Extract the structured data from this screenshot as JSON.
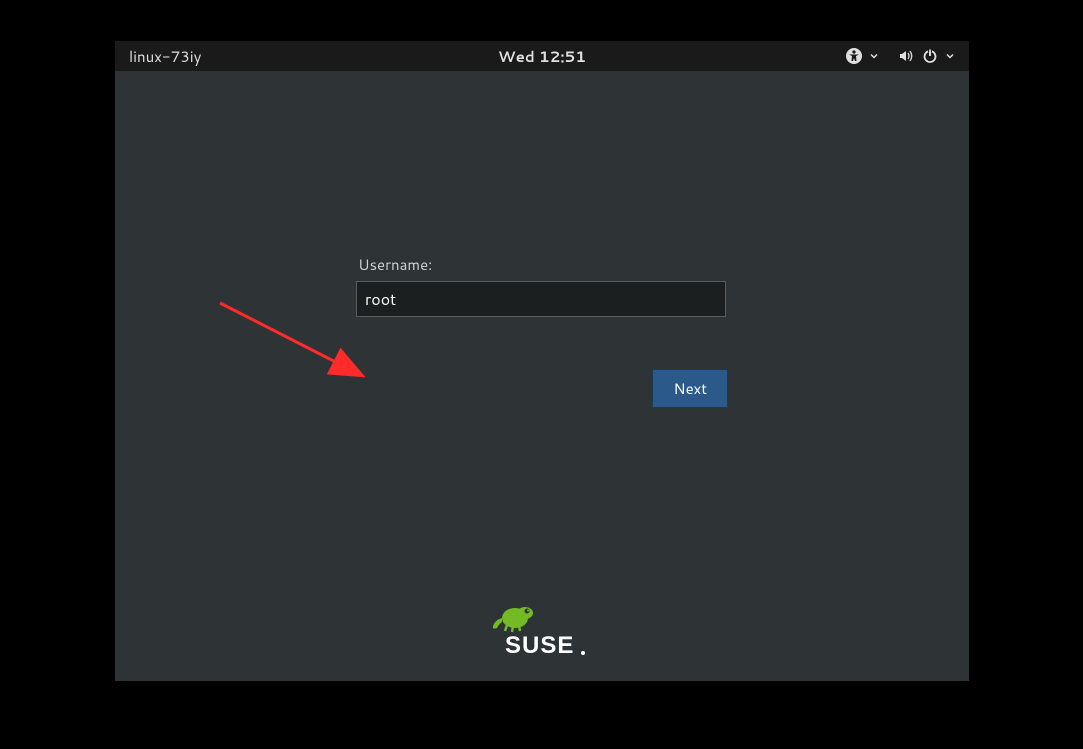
{
  "topbar": {
    "hostname": "linux-73iy",
    "clock": "Wed 12:51"
  },
  "login": {
    "username_label": "Username:",
    "username_value": "root",
    "next_button_label": "Next"
  },
  "branding": {
    "name": "SUSE"
  },
  "icons": {
    "accessibility": "accessibility-icon",
    "volume": "volume-icon",
    "power": "power-icon"
  },
  "colors": {
    "desktop_bg": "#2e3436",
    "topbar_bg": "#1a1a1a",
    "input_bg": "#1c1f20",
    "button_bg": "#2b5a8a",
    "suse_green": "#73ba25"
  }
}
